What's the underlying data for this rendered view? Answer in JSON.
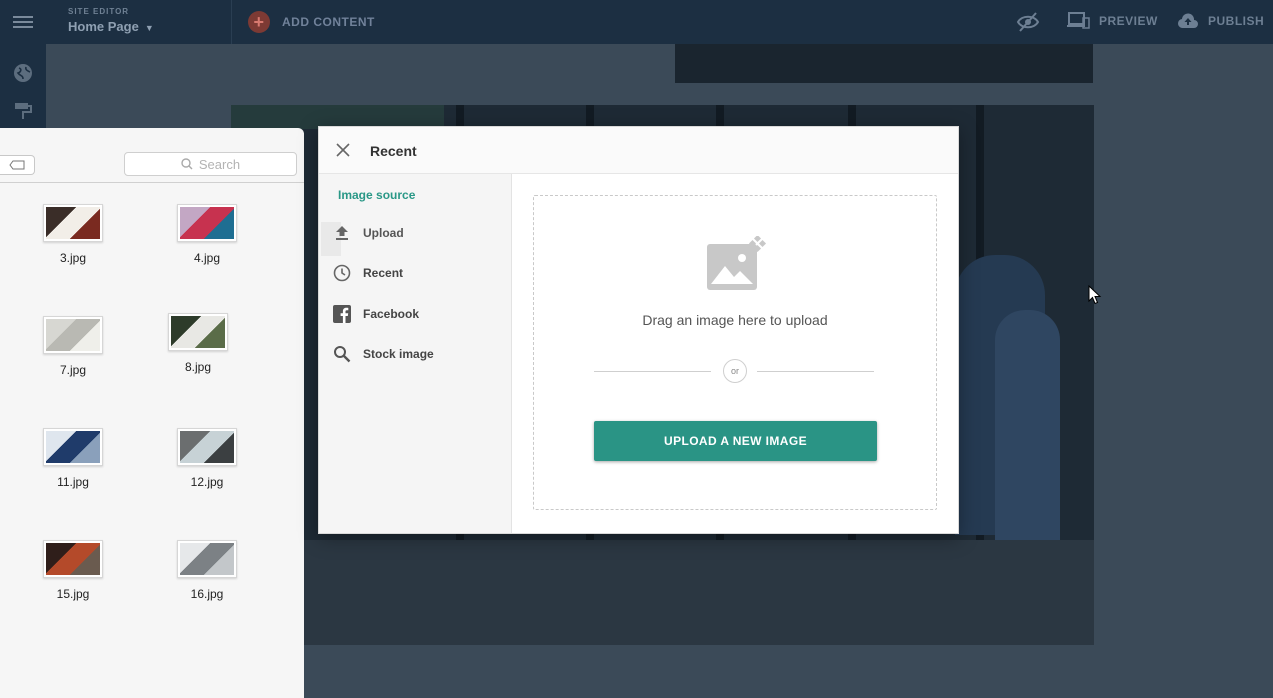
{
  "topbar": {
    "site_editor_label": "SITE EDITOR",
    "page_selector": "Home Page",
    "add_content_label": "ADD CONTENT",
    "preview_label": "PREVIEW",
    "publish_label": "PUBLISH",
    "brand_color": "#d87a70"
  },
  "left_rail": {
    "items": [
      {
        "icon": "globe-icon"
      },
      {
        "icon": "paint-roller-icon"
      }
    ]
  },
  "finder": {
    "search_placeholder": "Search",
    "files": [
      {
        "name": "3.jpg",
        "thumb_colors": [
          "#3a2d28",
          "#f2eee8",
          "#7a2a20"
        ]
      },
      {
        "name": "4.jpg",
        "thumb_colors": [
          "#c3a7c4",
          "#c7324f",
          "#1e6e92"
        ]
      },
      {
        "name": "7.jpg",
        "thumb_colors": [
          "#d7d7d2",
          "#b9b9b3",
          "#efefea"
        ]
      },
      {
        "name": "8.jpg",
        "thumb_colors": [
          "#2d3b2a",
          "#e8e8e4",
          "#5a6c48"
        ]
      },
      {
        "name": "11.jpg",
        "thumb_colors": [
          "#dfe6ee",
          "#1f3b6a",
          "#8aa0bb"
        ]
      },
      {
        "name": "12.jpg",
        "thumb_colors": [
          "#6b6e6f",
          "#c7d2d6",
          "#3b3f41"
        ]
      },
      {
        "name": "15.jpg",
        "thumb_colors": [
          "#2f1e1a",
          "#b44a2a",
          "#6a5b4f"
        ]
      },
      {
        "name": "16.jpg",
        "thumb_colors": [
          "#e6e8ea",
          "#7c8185",
          "#c3c7ca"
        ]
      }
    ]
  },
  "modal": {
    "title": "Recent",
    "side_heading": "Image source",
    "sources": [
      {
        "label": "Upload",
        "icon": "upload-icon"
      },
      {
        "label": "Recent",
        "icon": "clock-icon"
      },
      {
        "label": "Facebook",
        "icon": "facebook-icon"
      },
      {
        "label": "Stock image",
        "icon": "search-icon"
      }
    ],
    "drag_text": "Drag an image here to upload",
    "or_text": "or",
    "upload_button": "UPLOAD A NEW IMAGE",
    "accent_color": "#2a9485"
  }
}
